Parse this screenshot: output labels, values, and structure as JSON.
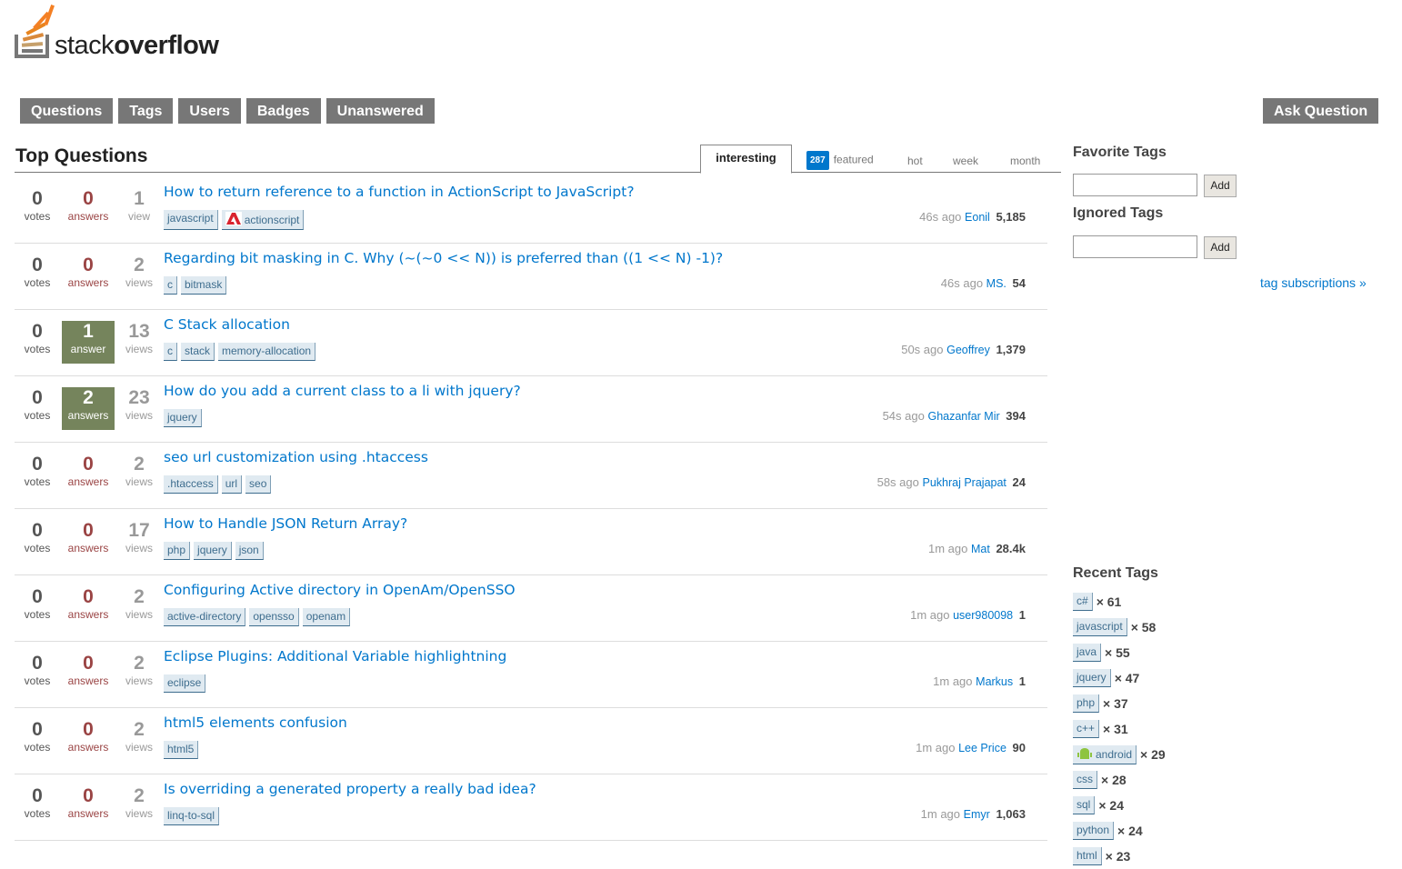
{
  "logo": {
    "text_regular": "stack",
    "text_bold": "overflow"
  },
  "nav": {
    "items": [
      "Questions",
      "Tags",
      "Users",
      "Badges",
      "Unanswered"
    ],
    "ask": "Ask Question"
  },
  "main": {
    "title": "Top Questions",
    "tabs": {
      "active": "interesting",
      "featured_count": "287",
      "featured": "featured",
      "hot": "hot",
      "week": "week",
      "month": "month"
    },
    "questions": [
      {
        "votes": "0",
        "votes_label": "votes",
        "answers": "0",
        "answers_label": "answers",
        "answers_state": "zero",
        "views": "1",
        "views_label": "view",
        "title": "How to return reference to a function in ActionScript to JavaScript?",
        "tags": [
          "javascript",
          "actionscript"
        ],
        "time": "46s ago",
        "user": "Eonil",
        "rep": "5,185"
      },
      {
        "votes": "0",
        "votes_label": "votes",
        "answers": "0",
        "answers_label": "answers",
        "answers_state": "zero",
        "views": "2",
        "views_label": "views",
        "title": "Regarding bit masking in C. Why (~(~0 << N)) is preferred than ((1 << N) -1)?",
        "tags": [
          "c",
          "bitmask"
        ],
        "time": "46s ago",
        "user": "MS.",
        "rep": "54"
      },
      {
        "votes": "0",
        "votes_label": "votes",
        "answers": "1",
        "answers_label": "answer",
        "answers_state": "accepted",
        "views": "13",
        "views_label": "views",
        "title": "C Stack allocation",
        "tags": [
          "c",
          "stack",
          "memory-allocation"
        ],
        "time": "50s ago",
        "user": "Geoffrey",
        "rep": "1,379"
      },
      {
        "votes": "0",
        "votes_label": "votes",
        "answers": "2",
        "answers_label": "answers",
        "answers_state": "accepted",
        "views": "23",
        "views_label": "views",
        "title": "How do you add a current class to a li with jquery?",
        "tags": [
          "jquery"
        ],
        "time": "54s ago",
        "user": "Ghazanfar Mir",
        "rep": "394"
      },
      {
        "votes": "0",
        "votes_label": "votes",
        "answers": "0",
        "answers_label": "answers",
        "answers_state": "zero",
        "views": "2",
        "views_label": "views",
        "title": "seo url customization using .htaccess",
        "tags": [
          ".htaccess",
          "url",
          "seo"
        ],
        "time": "58s ago",
        "user": "Pukhraj Prajapat",
        "rep": "24"
      },
      {
        "votes": "0",
        "votes_label": "votes",
        "answers": "0",
        "answers_label": "answers",
        "answers_state": "zero",
        "views": "17",
        "views_label": "views",
        "title": "How to Handle JSON Return Array?",
        "tags": [
          "php",
          "jquery",
          "json"
        ],
        "time": "1m ago",
        "user": "Mat",
        "rep": "28.4k"
      },
      {
        "votes": "0",
        "votes_label": "votes",
        "answers": "0",
        "answers_label": "answers",
        "answers_state": "zero",
        "views": "2",
        "views_label": "views",
        "title": "Configuring Active directory in OpenAm/OpenSSO",
        "tags": [
          "active-directory",
          "opensso",
          "openam"
        ],
        "time": "1m ago",
        "user": "user980098",
        "rep": "1"
      },
      {
        "votes": "0",
        "votes_label": "votes",
        "answers": "0",
        "answers_label": "answers",
        "answers_state": "zero",
        "views": "2",
        "views_label": "views",
        "title": "Eclipse Plugins: Additional Variable highlightning",
        "tags": [
          "eclipse"
        ],
        "time": "1m ago",
        "user": "Markus",
        "rep": "1"
      },
      {
        "votes": "0",
        "votes_label": "votes",
        "answers": "0",
        "answers_label": "answers",
        "answers_state": "zero",
        "views": "2",
        "views_label": "views",
        "title": "html5 elements confusion",
        "tags": [
          "html5"
        ],
        "time": "1m ago",
        "user": "Lee Price",
        "rep": "90"
      },
      {
        "votes": "0",
        "votes_label": "votes",
        "answers": "0",
        "answers_label": "answers",
        "answers_state": "zero",
        "views": "2",
        "views_label": "views",
        "title": "Is overriding a generated property a really bad idea?",
        "tags": [
          "linq-to-sql"
        ],
        "time": "1m ago",
        "user": "Emyr",
        "rep": "1,063"
      }
    ]
  },
  "sidebar": {
    "favorite_title": "Favorite Tags",
    "ignored_title": "Ignored Tags",
    "add_label": "Add",
    "subscriptions": "tag subscriptions »",
    "recent_title": "Recent Tags",
    "recent_tags": [
      {
        "tag": "c#",
        "count": "× 61"
      },
      {
        "tag": "javascript",
        "count": "× 58"
      },
      {
        "tag": "java",
        "count": "× 55"
      },
      {
        "tag": "jquery",
        "count": "× 47"
      },
      {
        "tag": "php",
        "count": "× 37"
      },
      {
        "tag": "c++",
        "count": "× 31"
      },
      {
        "tag": "android",
        "count": "× 29"
      },
      {
        "tag": "css",
        "count": "× 28"
      },
      {
        "tag": "sql",
        "count": "× 24"
      },
      {
        "tag": "python",
        "count": "× 24"
      },
      {
        "tag": "html",
        "count": "× 23"
      }
    ]
  },
  "colors": {
    "link": "#0077cc",
    "accepted": "#75845c",
    "zero_answers": "#9a4444",
    "nav": "#777777"
  }
}
